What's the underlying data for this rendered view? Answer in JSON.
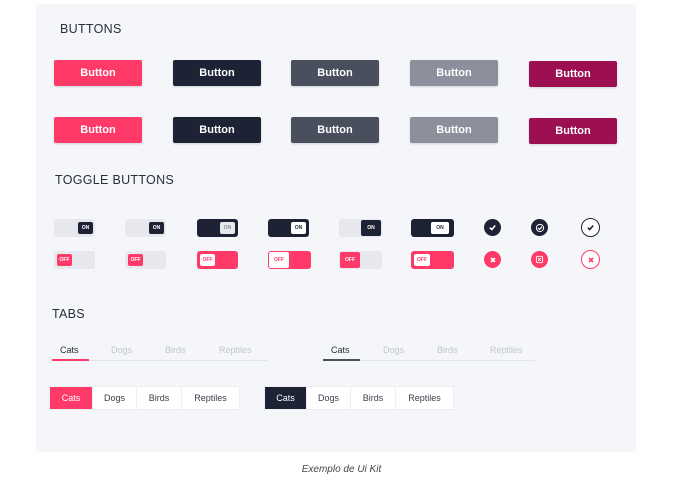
{
  "sections": {
    "buttons_title": "BUTTONS",
    "toggles_title": "TOGGLE BUTTONS",
    "tabs_title": "TABS"
  },
  "buttons": {
    "row1": [
      "Button",
      "Button",
      "Button",
      "Button",
      "Button"
    ],
    "row2": [
      "Button",
      "Button",
      "Button",
      "Button",
      "Button"
    ]
  },
  "colors": {
    "pink": "#ff3a68",
    "navy": "#1e2235",
    "slate": "#4a4f5e",
    "grey": "#8b909c",
    "magenta": "#9c0f51"
  },
  "toggles": {
    "row1": [
      "ON",
      "ON",
      "ON",
      "ON",
      "ON",
      "ON"
    ],
    "row2": [
      "OFF",
      "OFF",
      "OFF",
      "OFF",
      "OFF",
      "OFF"
    ]
  },
  "icons": {
    "row1": [
      "check-filled-icon",
      "check-outline-filled-icon",
      "check-outline-icon"
    ],
    "row2": [
      "close-filled-icon",
      "close-square-filled-icon",
      "close-outline-icon"
    ]
  },
  "tabs": {
    "underline_pink": [
      "Cats",
      "Dogs",
      "Birds",
      "Reptiles"
    ],
    "underline_dark": [
      "Cats",
      "Dogs",
      "Birds",
      "Reptiles"
    ],
    "segment_pink": [
      "Cats",
      "Dogs",
      "Birds",
      "Reptiles"
    ],
    "segment_dark": [
      "Cats",
      "Dogs",
      "Birds",
      "Reptiles"
    ],
    "selected": "Cats"
  },
  "caption": "Exemplo de Ui Kit"
}
